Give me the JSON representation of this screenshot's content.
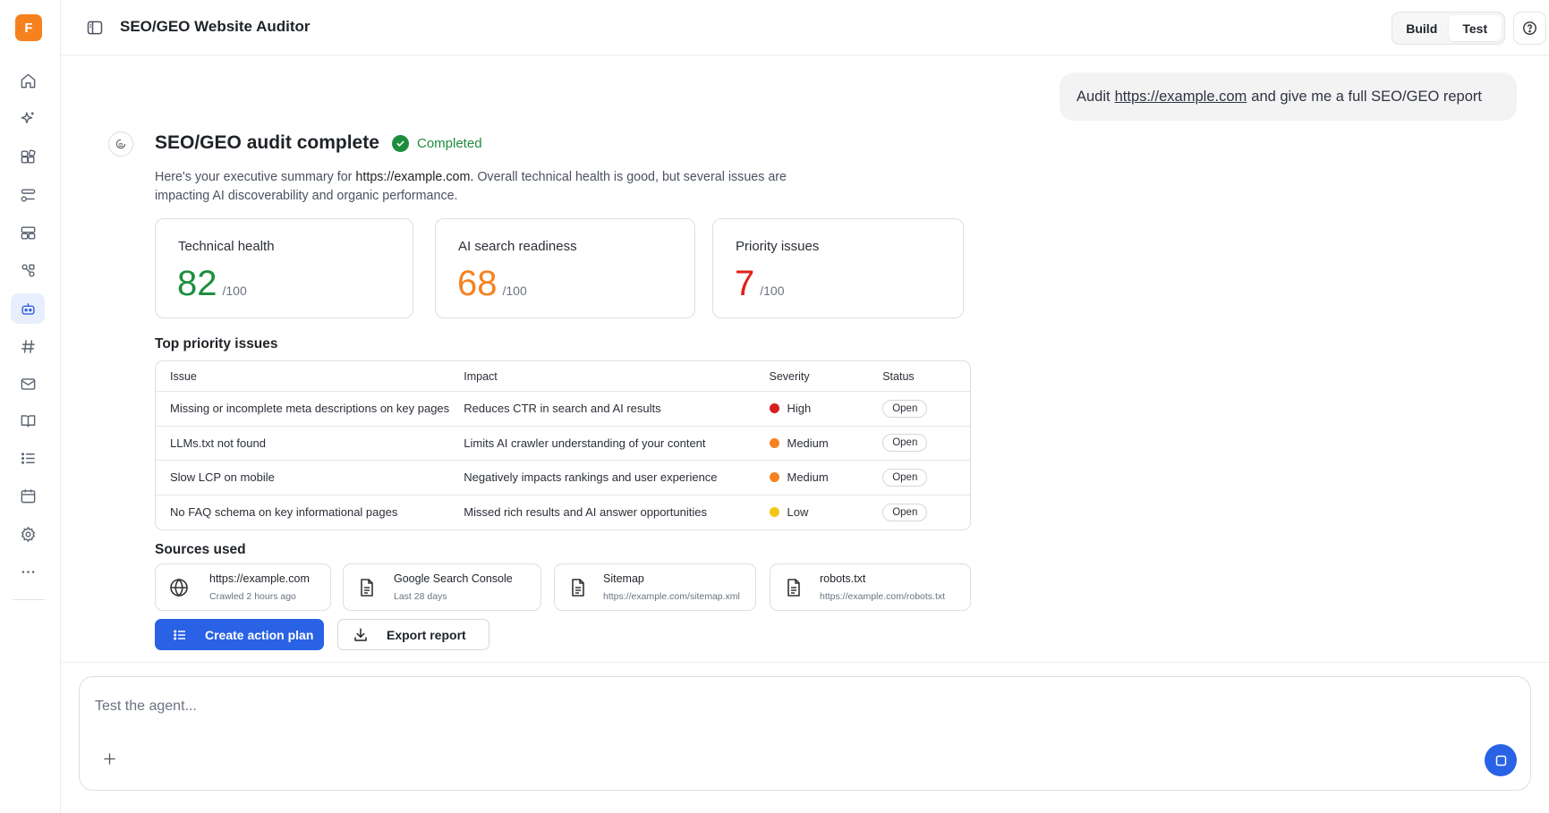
{
  "app": {
    "logo_letter": "F",
    "title": "SEO/GEO Website Auditor",
    "modes": [
      "Build",
      "Test"
    ],
    "active_mode": "Test",
    "brand_color": "#f5821f",
    "accent_color": "#2a62e6"
  },
  "sidebar": {
    "items": [
      {
        "name": "home",
        "icon": "home-icon"
      },
      {
        "name": "ai-spark",
        "icon": "sparkle-icon"
      },
      {
        "name": "apps",
        "icon": "apps-icon"
      },
      {
        "name": "workflows",
        "icon": "workflow-icon"
      },
      {
        "name": "layouts",
        "icon": "layout-icon"
      },
      {
        "name": "integrations",
        "icon": "nodes-icon"
      },
      {
        "name": "agents",
        "icon": "robot-icon",
        "active": true
      },
      {
        "name": "channels",
        "icon": "hash-icon"
      },
      {
        "name": "mail",
        "icon": "mail-icon"
      },
      {
        "name": "knowledge",
        "icon": "book-icon"
      },
      {
        "name": "lists",
        "icon": "list-icon"
      },
      {
        "name": "calendar",
        "icon": "calendar-icon"
      },
      {
        "name": "settings",
        "icon": "gear-icon"
      },
      {
        "name": "more",
        "icon": "more-icon"
      }
    ]
  },
  "user_message": {
    "prefix": "Audit",
    "link": "https://example.com",
    "suffix": "and give me a full SEO/GEO report"
  },
  "response": {
    "title": "SEO/GEO audit complete",
    "status": "Completed",
    "summary_prefix": "Here's your executive summary for",
    "summary_url": "https://example.com.",
    "summary_rest": "Overall technical health is good, but several issues are impacting AI discoverability and organic performance.",
    "scores": [
      {
        "label": "Technical health",
        "value": "82",
        "denominator": "/100",
        "color": "#1e8e3e"
      },
      {
        "label": "AI search readiness",
        "value": "68",
        "denominator": "/100",
        "color": "#f58220"
      },
      {
        "label": "Priority issues",
        "value": "7",
        "denominator": "/100",
        "color": "#e0201b"
      }
    ],
    "issues_heading": "Top priority issues",
    "issues_columns": [
      "Issue",
      "Impact",
      "Severity",
      "Status"
    ],
    "issues": [
      {
        "issue": "Missing or incomplete meta descriptions on key pages",
        "impact": "Reduces CTR in search and AI results",
        "severity": "High",
        "severity_color": "#d61f1f",
        "status": "Open"
      },
      {
        "issue": "LLMs.txt not found",
        "impact": "Limits AI crawler understanding of your content",
        "severity": "Medium",
        "severity_color": "#f58220",
        "status": "Open"
      },
      {
        "issue": "Slow LCP on mobile",
        "impact": "Negatively impacts rankings and user experience",
        "severity": "Medium",
        "severity_color": "#f58220",
        "status": "Open"
      },
      {
        "issue": "No FAQ schema on key informational pages",
        "impact": "Missed rich results and AI answer opportunities",
        "severity": "Low",
        "severity_color": "#f5c518",
        "status": "Open"
      }
    ],
    "sources_heading": "Sources used",
    "sources": [
      {
        "title": "https://example.com",
        "subtitle": "Crawled 2 hours ago",
        "icon": "globe-icon"
      },
      {
        "title": "Google Search Console",
        "subtitle": "Last 28 days",
        "icon": "document-icon"
      },
      {
        "title": "Sitemap",
        "subtitle": "https://example.com/sitemap.xml",
        "icon": "document-icon"
      },
      {
        "title": "robots.txt",
        "subtitle": "https://example.com/robots.txt",
        "icon": "document-icon"
      }
    ],
    "actions": {
      "primary": "Create action plan",
      "secondary": "Export report"
    }
  },
  "composer": {
    "placeholder": "Test the agent..."
  }
}
